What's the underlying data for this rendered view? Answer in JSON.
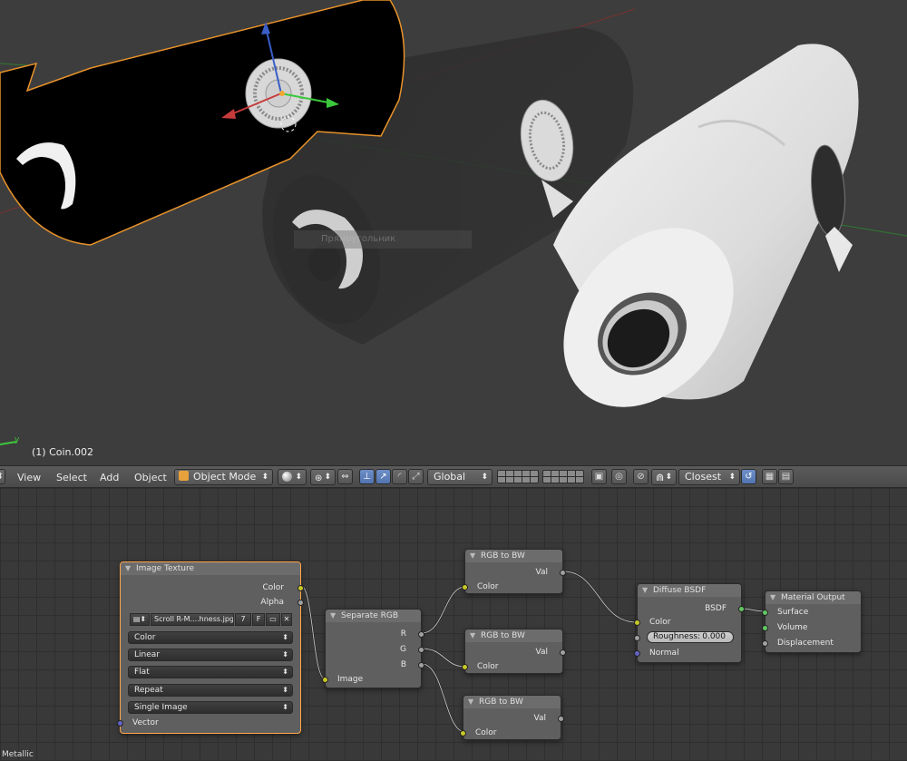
{
  "viewport": {
    "object_label": "(1) Coin.002",
    "tooltip_text": "Прямоугольник",
    "axis_label": "y"
  },
  "header": {
    "menus": [
      "View",
      "Select",
      "Add",
      "Object"
    ],
    "mode": "Object Mode",
    "orientation": "Global",
    "snap_target": "Closest"
  },
  "nodes": {
    "image_texture": {
      "title": "Image Texture",
      "outputs": [
        "Color",
        "Alpha"
      ],
      "image_name": "Scroll R-M....hness.jpg",
      "users": "7",
      "fake_user": "F",
      "color_space": "Color",
      "interpolation": "Linear",
      "projection": "Flat",
      "extension": "Repeat",
      "source": "Single Image",
      "input_vector": "Vector"
    },
    "separate_rgb": {
      "title": "Separate RGB",
      "outputs": [
        "R",
        "G",
        "B"
      ],
      "input": "Image"
    },
    "rgb_to_bw_1": {
      "title": "RGB to BW",
      "output": "Val",
      "input": "Color"
    },
    "rgb_to_bw_2": {
      "title": "RGB to BW",
      "output": "Val",
      "input": "Color"
    },
    "rgb_to_bw_3": {
      "title": "RGB to BW",
      "output": "Val",
      "input": "Color"
    },
    "diffuse": {
      "title": "Diffuse BSDF",
      "output": "BSDF",
      "input_color": "Color",
      "roughness_label": "Roughness:",
      "roughness_value": "0.000",
      "input_normal": "Normal"
    },
    "material_output": {
      "title": "Material Output",
      "inputs": [
        "Surface",
        "Volume",
        "Displacement"
      ]
    }
  },
  "footer": {
    "text": "Metallic"
  },
  "colors": {
    "socket_color": "#c7c729",
    "socket_float": "#a1a1a1",
    "socket_vector": "#6363c7",
    "socket_shader": "#63c763",
    "selection": "#ffa64a"
  }
}
